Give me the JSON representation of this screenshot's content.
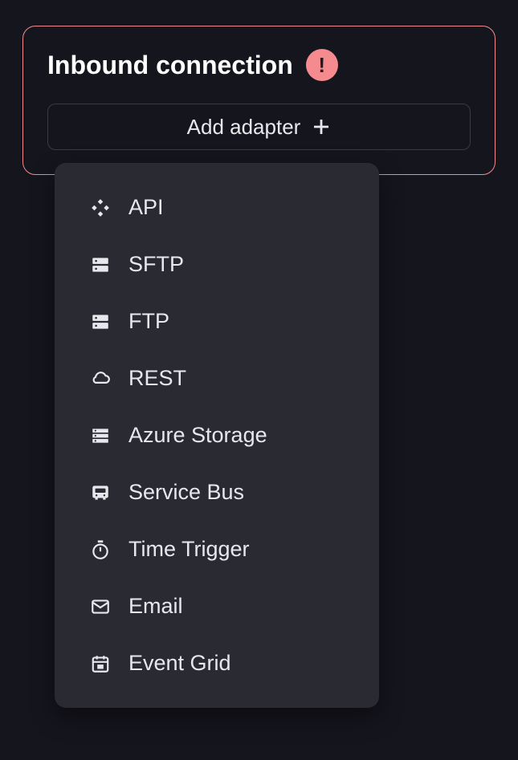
{
  "card": {
    "title": "Inbound connection",
    "warning_symbol": "!",
    "add_button_label": "Add adapter"
  },
  "menu": {
    "items": [
      {
        "label": "API",
        "icon": "api-icon"
      },
      {
        "label": "SFTP",
        "icon": "server-icon"
      },
      {
        "label": "FTP",
        "icon": "server-icon"
      },
      {
        "label": "REST",
        "icon": "cloud-icon"
      },
      {
        "label": "Azure Storage",
        "icon": "storage-icon"
      },
      {
        "label": "Service Bus",
        "icon": "bus-icon"
      },
      {
        "label": "Time Trigger",
        "icon": "timer-icon"
      },
      {
        "label": "Email",
        "icon": "email-icon"
      },
      {
        "label": "Event Grid",
        "icon": "calendar-icon"
      }
    ]
  }
}
